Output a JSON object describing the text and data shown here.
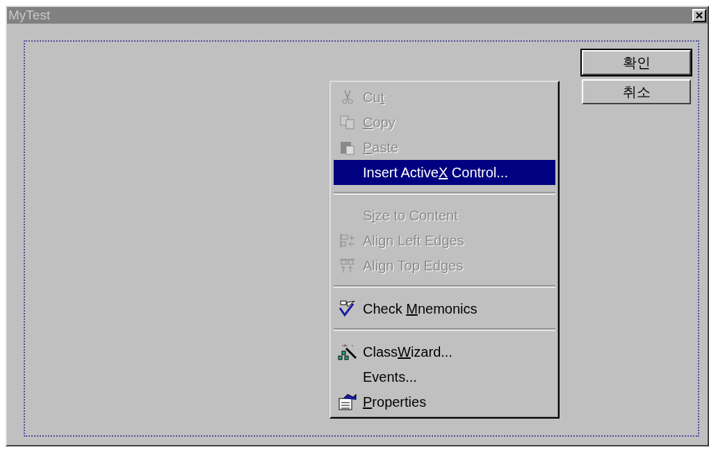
{
  "window": {
    "title": "MyTest",
    "active": false
  },
  "buttons": [
    {
      "label": "확인",
      "default": true
    },
    {
      "label": "취소",
      "default": false
    }
  ],
  "context_menu": {
    "items": [
      {
        "kind": "item",
        "label": "Cut",
        "disabled": true,
        "selected": false
      },
      {
        "kind": "item",
        "label": "Copy",
        "disabled": true,
        "selected": false
      },
      {
        "kind": "item",
        "label": "Paste",
        "disabled": true,
        "selected": false
      },
      {
        "kind": "item",
        "label": "Insert ActiveX Control...",
        "disabled": false,
        "selected": true
      },
      {
        "kind": "separator"
      },
      {
        "kind": "item",
        "label": "Size to Content",
        "disabled": true,
        "selected": false
      },
      {
        "kind": "item",
        "label": "Align Left Edges",
        "disabled": true,
        "selected": false
      },
      {
        "kind": "item",
        "label": "Align Top Edges",
        "disabled": true,
        "selected": false
      },
      {
        "kind": "separator"
      },
      {
        "kind": "item",
        "label": "Check Mnemonics",
        "disabled": false,
        "selected": false
      },
      {
        "kind": "separator"
      },
      {
        "kind": "item",
        "label": "ClassWizard...",
        "disabled": false,
        "selected": false
      },
      {
        "kind": "item",
        "label": "Events...",
        "disabled": false,
        "selected": false
      },
      {
        "kind": "item",
        "label": "Properties",
        "disabled": false,
        "selected": false
      }
    ]
  }
}
